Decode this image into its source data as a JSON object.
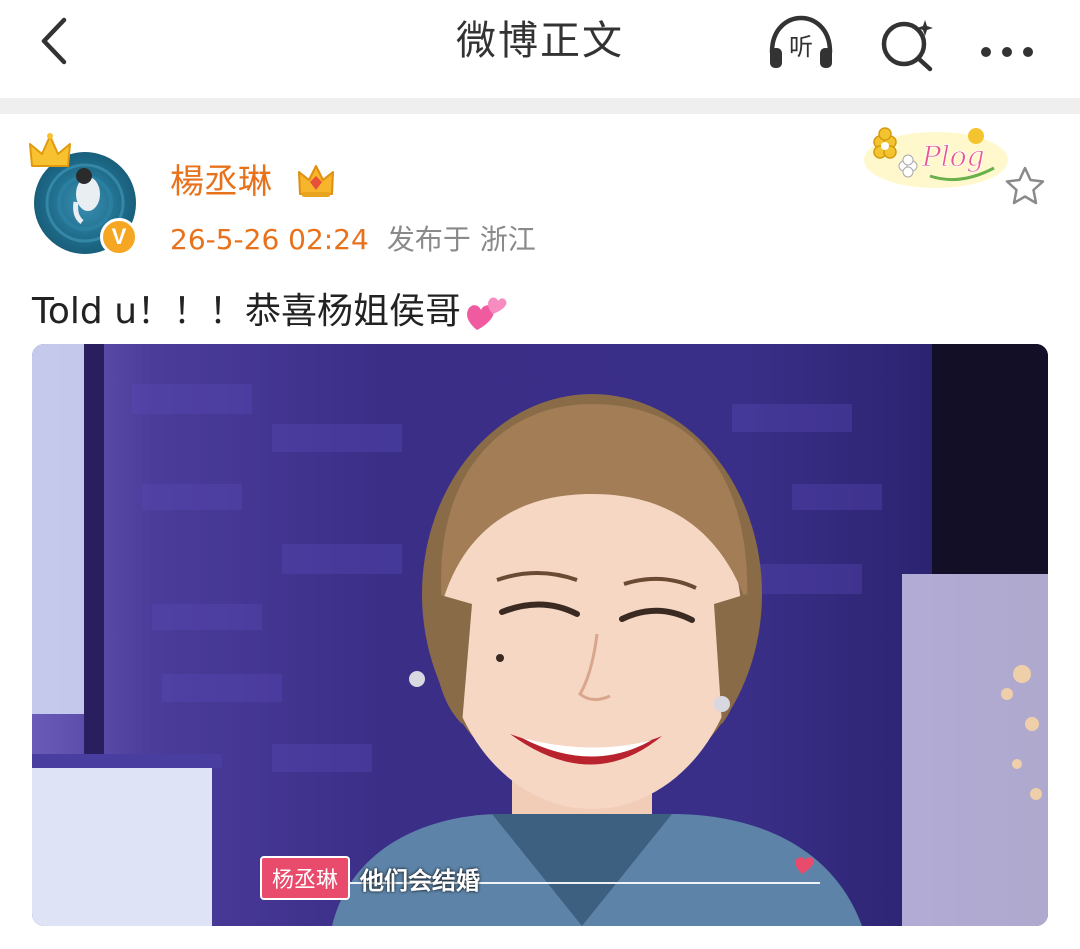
{
  "header": {
    "title": "微博正文",
    "listen_label": "听"
  },
  "post": {
    "username": "楊丞琳",
    "time": "26-5-26 02:24",
    "location": "发布于 浙江",
    "text": "Told u！！！恭喜杨姐侯哥",
    "badge_label": "V",
    "plog_label": "Plog"
  },
  "photo": {
    "caption_name": "杨丞琳",
    "caption_text": "他们会结婚"
  },
  "colors": {
    "accent": "#e8721c",
    "muted": "#8a8a8a",
    "divider": "#efefef",
    "badge": "#f5a623"
  }
}
